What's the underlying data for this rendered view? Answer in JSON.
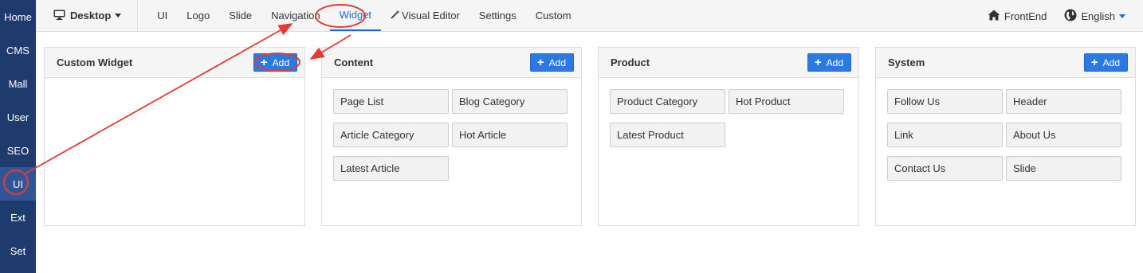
{
  "sidebar": {
    "items": [
      {
        "label": "Home"
      },
      {
        "label": "CMS"
      },
      {
        "label": "Mall"
      },
      {
        "label": "User"
      },
      {
        "label": "SEO"
      },
      {
        "label": "UI"
      },
      {
        "label": "Ext"
      },
      {
        "label": "Set"
      }
    ],
    "active": "UI"
  },
  "topbar": {
    "device_label": "Desktop",
    "nav": [
      "UI",
      "Logo",
      "Slide",
      "Navigation",
      "Widget",
      "Visual Editor",
      "Settings",
      "Custom"
    ],
    "active_nav": "Widget",
    "frontend_label": "FrontEnd",
    "language_label": "English"
  },
  "panels": [
    {
      "title": "Custom Widget",
      "add_label": "Add",
      "widgets": []
    },
    {
      "title": "Content",
      "add_label": "Add",
      "widgets": [
        "Page List",
        "Blog Category",
        "Article Category",
        "Hot Article",
        "Latest Article"
      ]
    },
    {
      "title": "Product",
      "add_label": "Add",
      "widgets": [
        "Product Category",
        "Hot Product",
        "Latest Product"
      ]
    },
    {
      "title": "System",
      "add_label": "Add",
      "widgets": [
        "Follow Us",
        "Header",
        "Link",
        "About Us",
        "Contact Us",
        "Slide"
      ]
    }
  ],
  "colors": {
    "sidebar": "#1f3b6e",
    "accent": "#1a6bd1",
    "add_button": "#2a7ae2",
    "annotation": "#e53935"
  }
}
